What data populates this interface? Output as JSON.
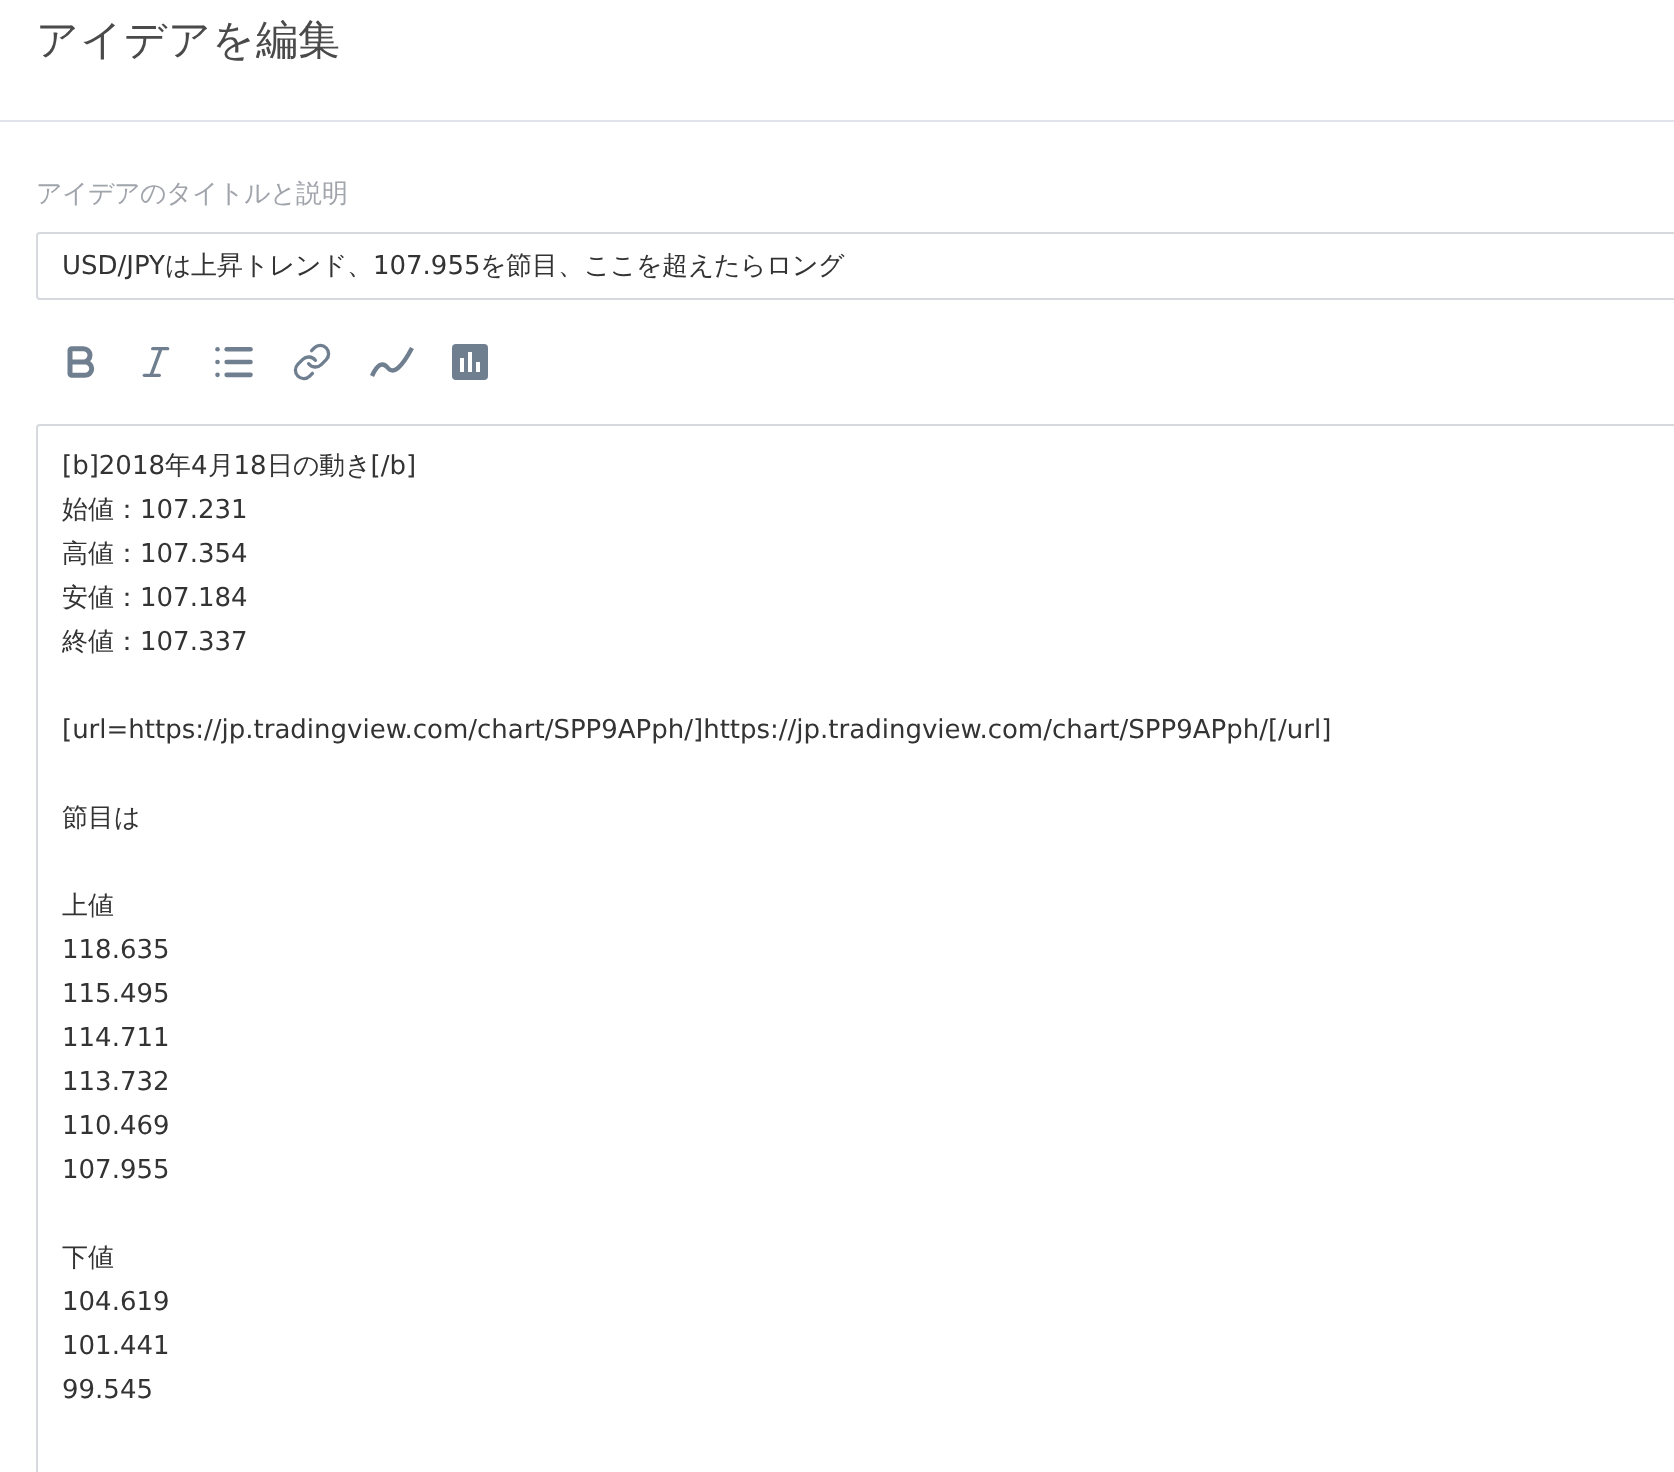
{
  "header": {
    "title": "アイデアを編集"
  },
  "form": {
    "label": "アイデアのタイトルと説明",
    "title_value": "USD/JPYは上昇トレンド、107.955を節目、ここを超えたらロング",
    "toolbar": [
      {
        "kind": "bold"
      },
      {
        "kind": "italic"
      },
      {
        "kind": "list"
      },
      {
        "kind": "link"
      },
      {
        "kind": "curve"
      },
      {
        "kind": "chart"
      }
    ],
    "description_blocks": [
      [
        "[b]2018年4月18日の動き[/b]",
        "始値：107.231",
        "高値：107.354",
        "安値：107.184",
        "終値：107.337"
      ],
      [
        "[url=https://jp.tradingview.com/chart/SPP9APph/]https://jp.tradingview.com/chart/SPP9APph/[/url]"
      ],
      [
        "節目は"
      ],
      [
        "上値",
        "118.635",
        "115.495",
        "114.711",
        "113.732",
        "110.469",
        "107.955"
      ],
      [
        "下値",
        "104.619",
        "101.441",
        "99.545"
      ]
    ]
  }
}
